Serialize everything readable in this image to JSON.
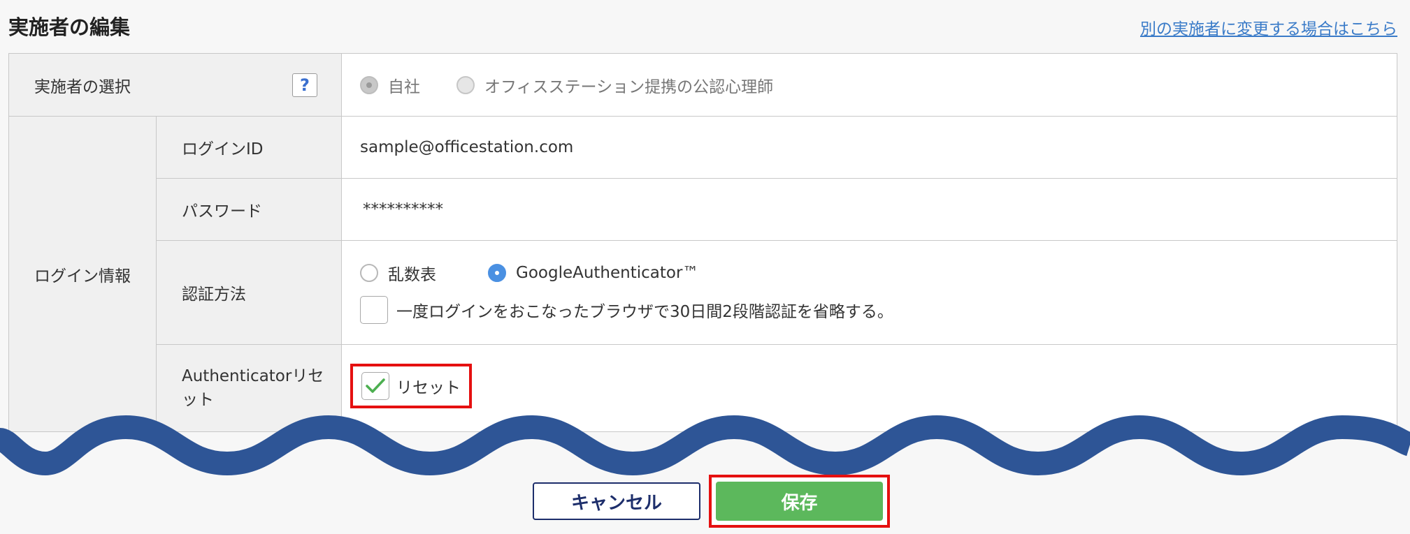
{
  "page": {
    "title": "実施者の編集",
    "change_link": "別の実施者に変更する場合はこちら"
  },
  "form": {
    "implementer": {
      "label": "実施者の選択",
      "help": "?",
      "options": [
        "自社",
        "オフィスステーション提携の公認心理師"
      ],
      "selected": "自社"
    },
    "login_info": {
      "label": "ログイン情報",
      "login_id": {
        "label": "ログインID",
        "value": "sample@officestation.com"
      },
      "password": {
        "label": "パスワード",
        "value": "**********"
      },
      "auth_method": {
        "label": "認証方法",
        "options": [
          "乱数表",
          "GoogleAuthenticator™"
        ],
        "selected": "GoogleAuthenticator™",
        "skip_checkbox_label": "一度ログインをおこなったブラウザで30日間2段階認証を省略する。",
        "skip_checked": false
      },
      "auth_reset": {
        "label": "Authenticatorリセット",
        "checkbox_label": "リセット",
        "checked": true
      }
    }
  },
  "buttons": {
    "cancel": "キャンセル",
    "save": "保存"
  },
  "colors": {
    "save": "#5cb85c",
    "link": "#3a7bc8",
    "highlight": "#e51010",
    "wave": "#2e5596",
    "check": "#4caf50",
    "radio_selected": "#4a90e2"
  }
}
